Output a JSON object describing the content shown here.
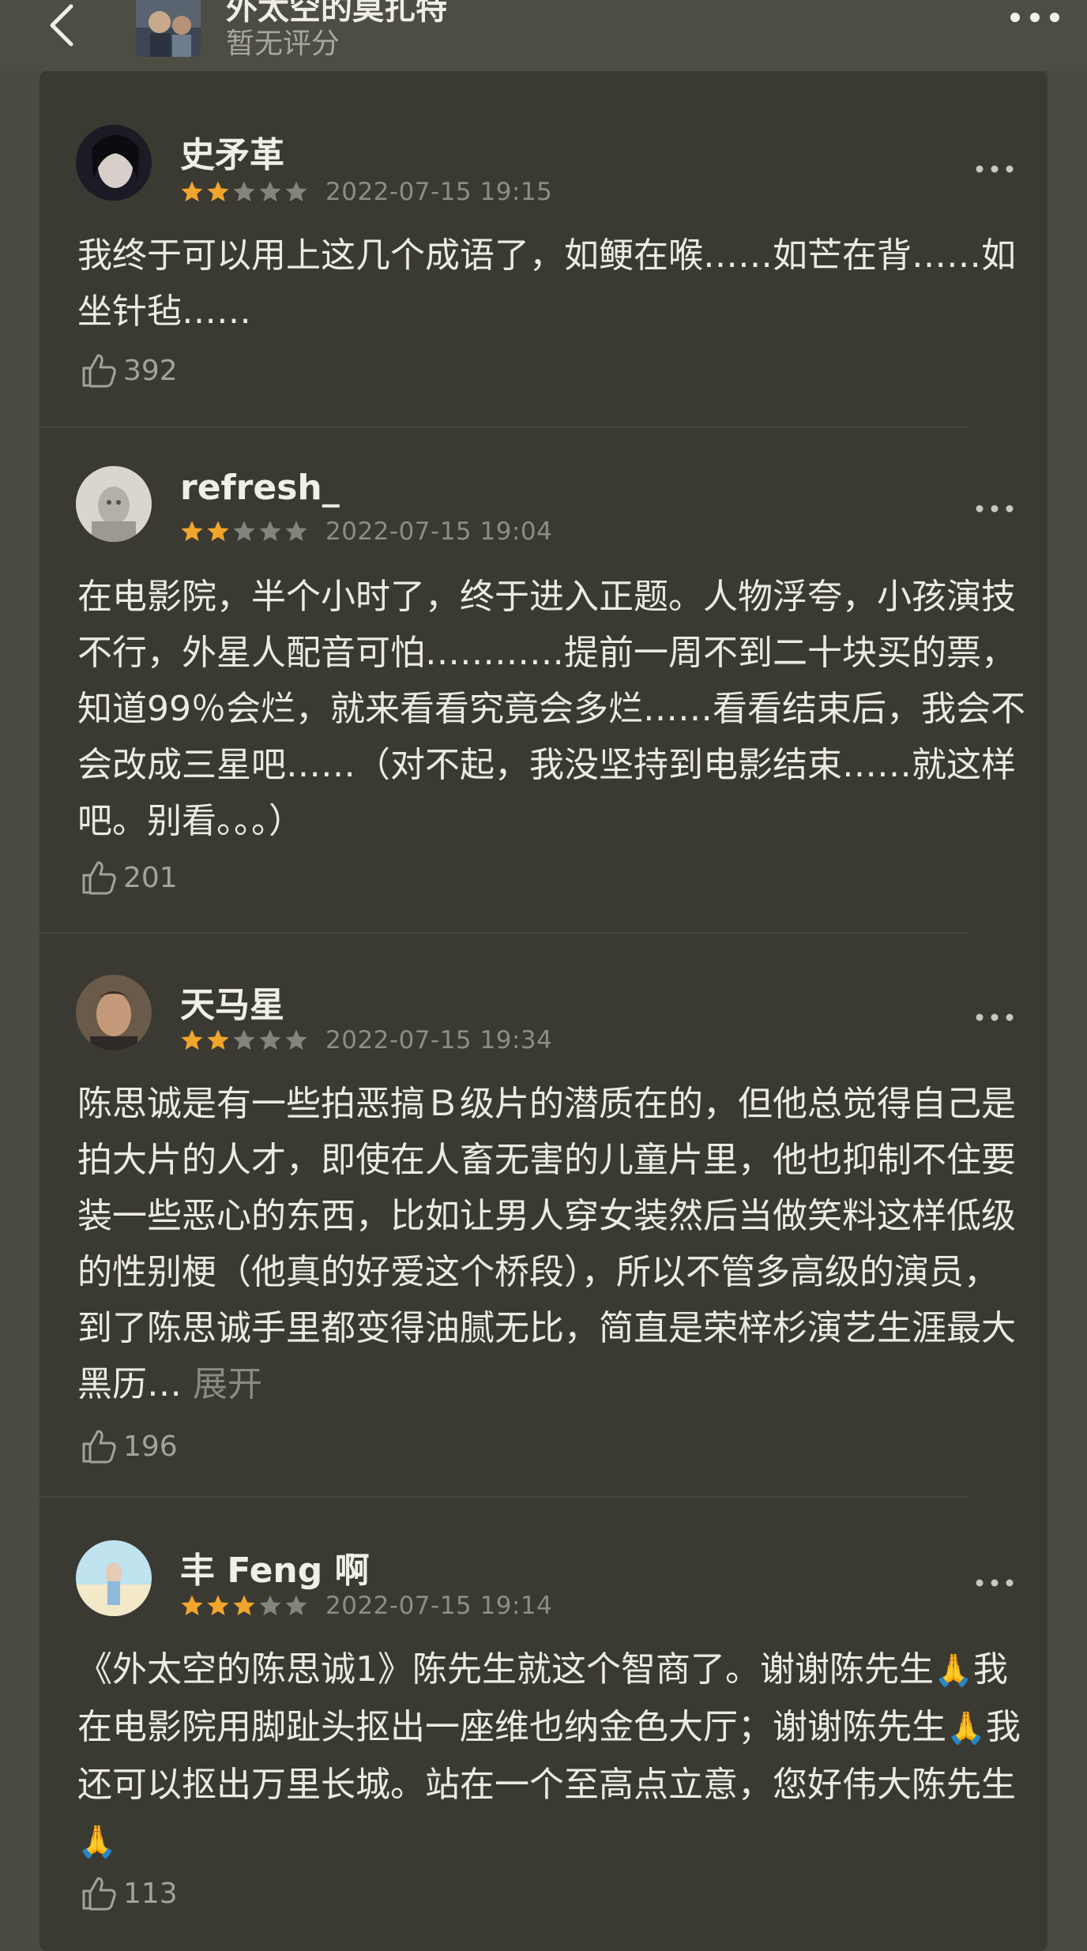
{
  "header": {
    "title": "外太空的莫扎特",
    "rating_text": "暂无评分",
    "icons": {
      "back": "chevron-left-icon",
      "more": "more-dots-icon"
    }
  },
  "colors": {
    "star_filled": "#f2a52c",
    "star_empty": "#85847c",
    "panel": "#3a3a33",
    "page": "#4b4a40"
  },
  "reviews": [
    {
      "user": "史矛革",
      "stars": 2,
      "date": "2022-07-15 19:15",
      "text": "我终于可以用上这几个成语了，如鲠在喉……如芒在背……如坐针毡……",
      "likes": "392"
    },
    {
      "user": "refresh_",
      "stars": 2,
      "date": "2022-07-15 19:04",
      "text": "在电影院，半个小时了，终于进入正题。人物浮夸，小孩演技不行，外星人配音可怕…………提前一周不到二十块买的票，知道99％会烂，就来看看究竟会多烂……看看结束后，我会不会改成三星吧……（对不起，我没坚持到电影结束……就这样吧。别看。。。）",
      "likes": "201"
    },
    {
      "user": "天马星",
      "stars": 2,
      "date": "2022-07-15 19:34",
      "text": "陈思诚是有一些拍恶搞Ｂ级片的潜质在的，但他总觉得自己是拍大片的人才，即使在人畜无害的儿童片里，他也抑制不住要装一些恶心的东西，比如让男人穿女装然后当做笑料这样低级的性别梗（他真的好爱这个桥段），所以不管多高级的演员，到了陈思诚手里都变得油腻无比，简直是荣梓杉演艺生涯最大黑历…",
      "expand": "展开",
      "likes": "196"
    },
    {
      "user": "丰 Feng 啊",
      "stars": 3,
      "date": "2022-07-15 19:14",
      "text_parts": [
        "《外太空的陈思诚1》陈先生就这个智商了。谢谢陈先生",
        "🙏",
        "我在电影院用脚趾头抠出一座维也纳金色大厅；谢谢陈先生",
        "🙏",
        "我还可以抠出万里长城。站在一个至高点立意，您好伟大陈先生",
        "🙏"
      ],
      "likes": "113"
    }
  ]
}
